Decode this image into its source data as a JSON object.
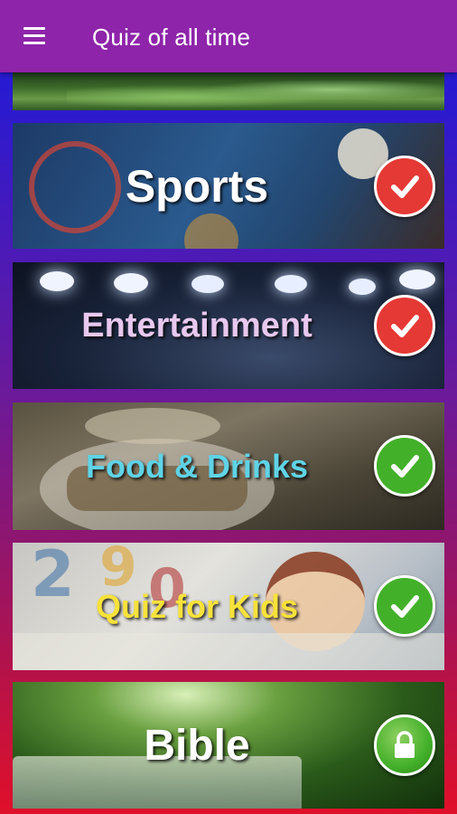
{
  "app": {
    "title": "Quiz of all time",
    "menu_icon": "hamburger-menu-icon"
  },
  "categories": [
    {
      "label": "",
      "status": "completed",
      "status_icon": "check-icon",
      "badge_color": "#e53935"
    },
    {
      "label": "Sports",
      "status": "completed",
      "status_icon": "check-icon",
      "label_color": "#ffffff",
      "badge_color": "#e53935"
    },
    {
      "label": "Entertainment",
      "status": "completed",
      "status_icon": "check-icon",
      "label_color": "#e8c8ee",
      "badge_color": "#e53935"
    },
    {
      "label": "Food & Drinks",
      "status": "completed",
      "status_icon": "check-icon",
      "label_color": "#5fd3e6",
      "badge_color": "#43b02a"
    },
    {
      "label": "Quiz for Kids",
      "status": "completed",
      "status_icon": "check-icon",
      "label_color": "#f7e23a",
      "badge_color": "#43b02a"
    },
    {
      "label": "Bible",
      "status": "locked",
      "status_icon": "lock-icon",
      "label_color": "#ffffff",
      "badge_color": "#43b02a"
    }
  ],
  "colors": {
    "appbar": "#8e24aa",
    "completed_red": "#e53935",
    "completed_green": "#43b02a"
  }
}
